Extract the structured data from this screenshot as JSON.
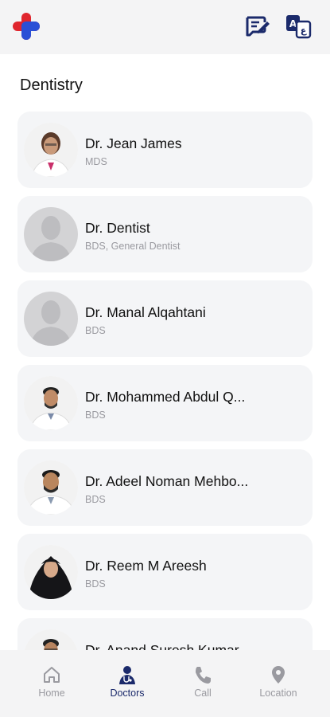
{
  "section_title": "Dentistry",
  "colors": {
    "brand_navy": "#1b2a6b",
    "brand_red": "#e0262e",
    "brand_blue": "#2b4fd6",
    "inactive": "#9a9aa0"
  },
  "header": {
    "edit_icon": "edit-note-icon",
    "lang_icon": "translate-icon"
  },
  "doctors": [
    {
      "name": "Dr. Jean James",
      "title": "MDS",
      "avatar": "photo"
    },
    {
      "name": "Dr. Dentist",
      "title": "BDS, General Dentist",
      "avatar": "placeholder"
    },
    {
      "name": "Dr. Manal Alqahtani",
      "title": "BDS",
      "avatar": "placeholder"
    },
    {
      "name": "Dr. Mohammed Abdul Q...",
      "title": "BDS",
      "avatar": "photo"
    },
    {
      "name": "Dr. Adeel Noman Mehbo...",
      "title": "BDS",
      "avatar": "photo"
    },
    {
      "name": "Dr. Reem M Areesh",
      "title": "BDS",
      "avatar": "photo"
    },
    {
      "name": "Dr. Anand Suresh Kumar",
      "title": "",
      "avatar": "photo"
    }
  ],
  "nav": [
    {
      "label": "Home",
      "icon": "home-icon",
      "active": false
    },
    {
      "label": "Doctors",
      "icon": "doctor-icon",
      "active": true
    },
    {
      "label": "Call",
      "icon": "phone-icon",
      "active": false
    },
    {
      "label": "Location",
      "icon": "location-pin-icon",
      "active": false
    }
  ]
}
